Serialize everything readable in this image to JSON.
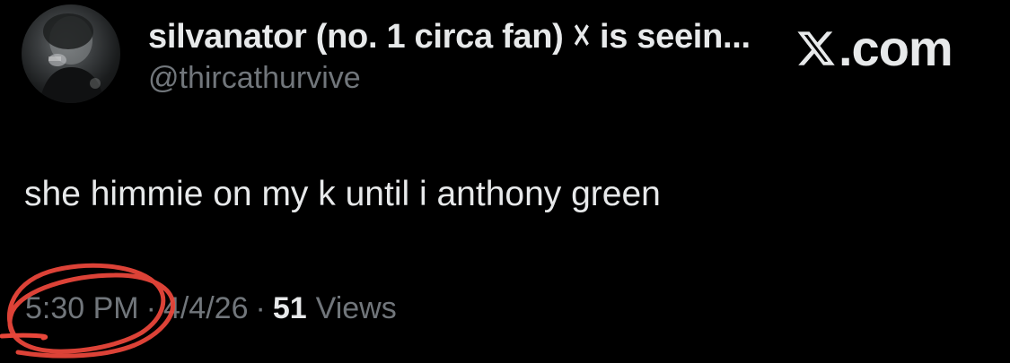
{
  "author": {
    "display_name": "silvanator (no. 1 circa fan) ☓ is seein...",
    "handle": "@thircathurvive",
    "avatar_icon": "user-avatar-photo"
  },
  "brand": {
    "logo_icon": "x-logo-icon",
    "text": ".com"
  },
  "tweet": {
    "text": "she himmie on my k until i anthony green"
  },
  "meta": {
    "time": "5:30 PM",
    "separator1": "·",
    "date": "4/4/26",
    "separator2": "·",
    "views_count": "51",
    "views_label": "Views"
  },
  "colors": {
    "background": "#000000",
    "primary_text": "#e7e9ea",
    "secondary_text": "#71767b",
    "annotation": "#e8463a"
  }
}
